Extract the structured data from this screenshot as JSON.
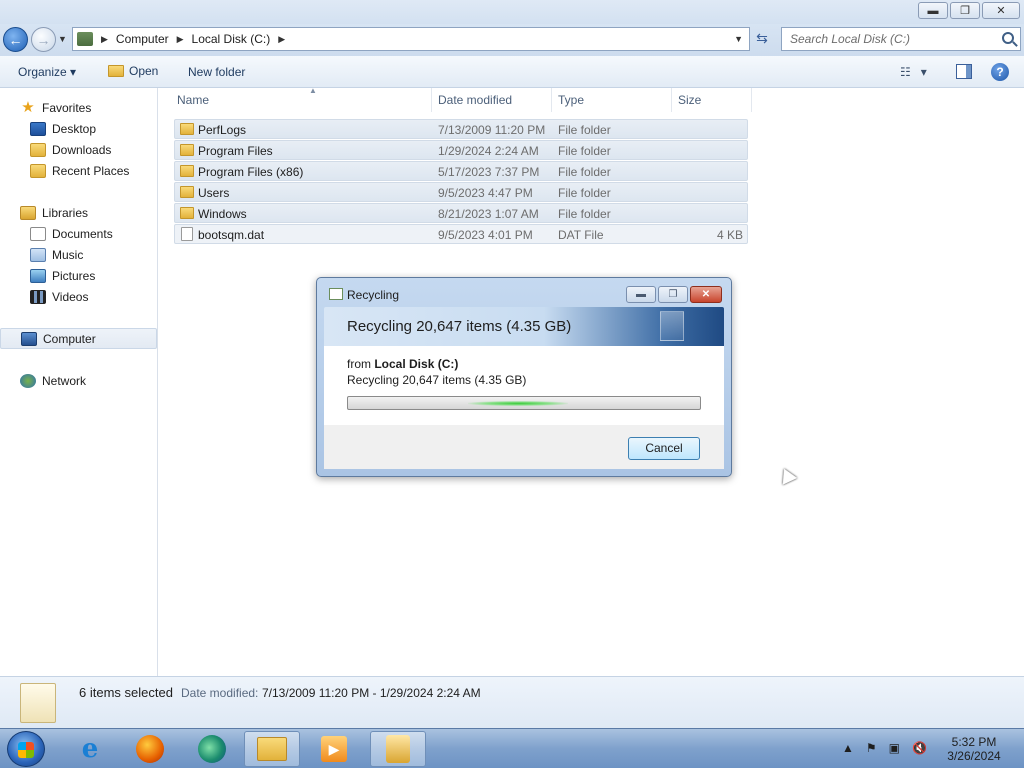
{
  "window": {
    "minimize": "▬",
    "maximize": "❐",
    "close": "✕"
  },
  "address": {
    "segments": [
      "Computer",
      "Local Disk (C:)"
    ],
    "search_placeholder": "Search Local Disk (C:)"
  },
  "toolbar": {
    "organize_label": "Organize",
    "open_label": "Open",
    "new_folder_label": "New folder"
  },
  "navigation": {
    "favorites": "Favorites",
    "desktop": "Desktop",
    "downloads": "Downloads",
    "recent_places": "Recent Places",
    "libraries": "Libraries",
    "documents": "Documents",
    "music": "Music",
    "pictures": "Pictures",
    "videos": "Videos",
    "computer": "Computer",
    "network": "Network"
  },
  "columns": {
    "name": "Name",
    "date_modified": "Date modified",
    "type": "Type",
    "size": "Size"
  },
  "files": [
    {
      "name": "PerfLogs",
      "date": "7/13/2009 11:20 PM",
      "type": "File folder",
      "size": ""
    },
    {
      "name": "Program Files",
      "date": "1/29/2024 2:24 AM",
      "type": "File folder",
      "size": ""
    },
    {
      "name": "Program Files (x86)",
      "date": "5/17/2023 7:37 PM",
      "type": "File folder",
      "size": ""
    },
    {
      "name": "Users",
      "date": "9/5/2023 4:47 PM",
      "type": "File folder",
      "size": ""
    },
    {
      "name": "Windows",
      "date": "8/21/2023 1:07 AM",
      "type": "File folder",
      "size": ""
    },
    {
      "name": "bootsqm.dat",
      "date": "9/5/2023 4:01 PM",
      "type": "DAT File",
      "size": "4 KB"
    }
  ],
  "status": {
    "count": "6 items selected",
    "date_label": "Date modified:",
    "date_value": "7/13/2009 11:20 PM - 1/29/2024 2:24 AM"
  },
  "dialog": {
    "title": "Recycling",
    "heading": "Recycling 20,647 items (4.35 GB)",
    "from_prefix": "from",
    "from_location": "Local Disk (C:)",
    "detail": "Recycling 20,647 items (4.35 GB)",
    "cancel_label": "Cancel",
    "progress": 0.5
  },
  "taskbar": {
    "time": "5:32 PM",
    "date": "3/26/2024",
    "ie_glyph": "e",
    "media_glyph": "▶"
  }
}
